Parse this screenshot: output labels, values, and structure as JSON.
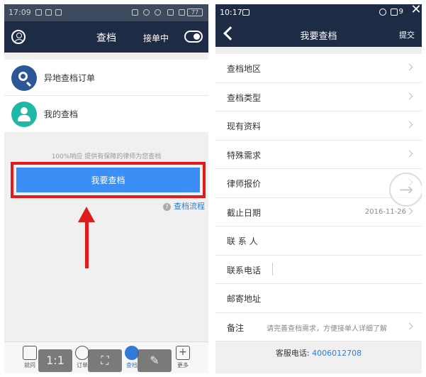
{
  "left_screen": {
    "status_bar": {
      "time": "17:09",
      "battery": "77"
    },
    "header": {
      "title": "查档",
      "order_status": "接单中"
    },
    "menu": [
      {
        "label": "异地查档订单",
        "icon": "search-icon",
        "color": "#2b5797"
      },
      {
        "label": "我的查档",
        "icon": "lawyer-icon",
        "color": "#1fb8a4"
      }
    ],
    "promo_text": "100%响应  提供有保障的律师为您查档",
    "cta_label": "我要查档",
    "flow_link": "查档流程",
    "tabs": [
      {
        "label": "就问",
        "icon": "briefcase-icon"
      },
      {
        "label": "订单",
        "icon": "list-icon"
      },
      {
        "label": "查档",
        "icon": "search-icon",
        "active": true
      },
      {
        "label": "更多",
        "icon": "plus-icon"
      }
    ],
    "viewer_buttons": [
      "1:1",
      "fit-screen-icon",
      "edit-icon"
    ],
    "accent_color": "#3a8ef5",
    "highlight_color": "#e01b1b"
  },
  "right_screen": {
    "status_bar": {
      "time": "10:17",
      "battery": "9"
    },
    "header": {
      "title": "我要查档",
      "submit_label": "提交"
    },
    "form_rows": [
      {
        "label": "查档地区",
        "value": "",
        "chevron": true
      },
      {
        "label": "查档类型",
        "value": "",
        "chevron": true
      },
      {
        "label": "现有资料",
        "value": "",
        "chevron": true
      },
      {
        "label": "特殊需求",
        "value": "",
        "chevron": true
      },
      {
        "label": "律师报价",
        "value": "",
        "chevron": true
      },
      {
        "label": "截止日期",
        "value": "2016-11-26",
        "chevron": true
      },
      {
        "label": "联 系 人",
        "value": "",
        "chevron": false
      },
      {
        "label": "联系电话",
        "value": "",
        "chevron": false
      },
      {
        "label": "邮寄地址",
        "value": "",
        "chevron": false
      },
      {
        "label": "备注",
        "hint": "请完善查档需求，方便接单人详细了解",
        "chevron": true
      }
    ],
    "service_label": "客服电话: ",
    "service_phone": "4006012708"
  }
}
